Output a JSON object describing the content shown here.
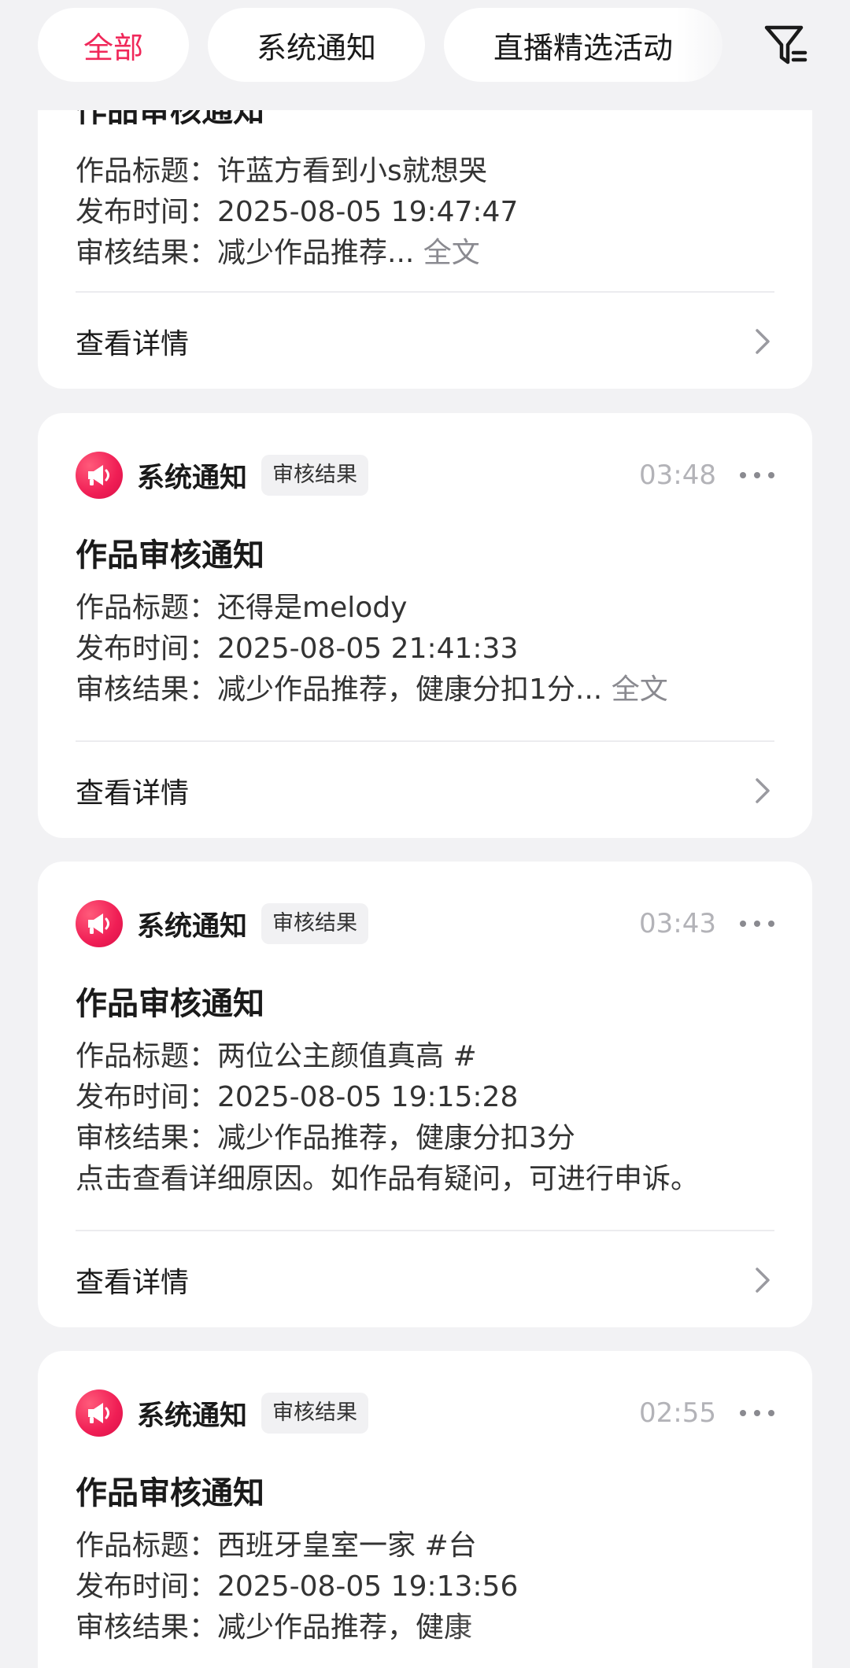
{
  "filters": {
    "all": "全部",
    "system": "系统通知",
    "live": "直播精选活动"
  },
  "colors": {
    "accent": "#f0285a",
    "background": "#f2f2f4",
    "card": "#ffffff"
  },
  "icons": {
    "filter": "filter-icon",
    "sender": "megaphone-icon",
    "more": "more-dots-icon",
    "chevron": "chevron-right-icon"
  },
  "card0": {
    "title_partial": "作品审核通知",
    "line1": "作品标题：许蓝方看到小s就想哭",
    "line2": "发布时间：2025-08-05 19:47:47",
    "line3": "审核结果：减少作品推荐...",
    "full_text": "全文",
    "detail": "查看详情"
  },
  "card1": {
    "sender": "系统通知",
    "badge": "审核结果",
    "time": "03:48",
    "title": "作品审核通知",
    "line1": "作品标题：还得是melody",
    "line2": "发布时间：2025-08-05 21:41:33",
    "line3": "审核结果：减少作品推荐，健康分扣1分...",
    "full_text": "全文",
    "detail": "查看详情"
  },
  "card2": {
    "sender": "系统通知",
    "badge": "审核结果",
    "time": "03:43",
    "title": "作品审核通知",
    "line1": "作品标题：两位公主颜值真高 #",
    "line2": "发布时间：2025-08-05 19:15:28",
    "line3": "审核结果：减少作品推荐，健康分扣3分",
    "line4": "点击查看详细原因。如作品有疑问，可进行申诉。",
    "detail": "查看详情"
  },
  "card3": {
    "sender": "系统通知",
    "badge": "审核结果",
    "time": "02:55",
    "title": "作品审核通知",
    "line1": "作品标题：西班牙皇室一家 #台",
    "line2": "发布时间：2025-08-05 19:13:56",
    "line3": "审核结果：减少作品推荐，健康"
  }
}
